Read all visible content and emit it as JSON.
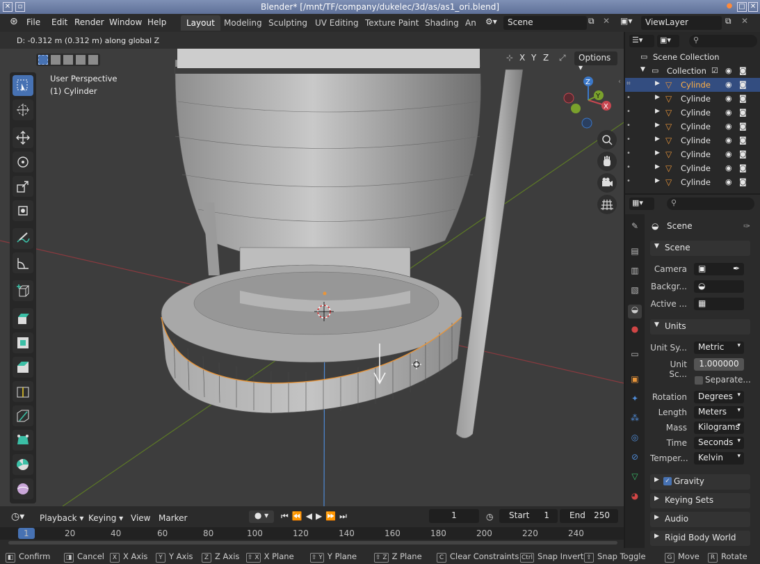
{
  "window": {
    "title": "Blender* [/mnt/TF/company/dukelec/3d/as/as1_ori.blend]"
  },
  "menu": [
    "File",
    "Edit",
    "Render",
    "Window",
    "Help"
  ],
  "workspaces": [
    "Layout",
    "Modeling",
    "Sculpting",
    "UV Editing",
    "Texture Paint",
    "Shading",
    "An"
  ],
  "scene_field": "Scene",
  "viewlayer_field": "ViewLayer",
  "viewport": {
    "status": "D: -0.312 m (0.312 m) along global Z",
    "perspective": "User Perspective",
    "object": "(1) Cylinder",
    "axis_x": "X",
    "axis_y": "Y",
    "axis_z": "Z",
    "options": "Options"
  },
  "gizmo": {
    "x": "X",
    "y": "Y",
    "z": "Z"
  },
  "outliner": {
    "scene_collection": "Scene Collection",
    "collection": "Collection",
    "items": [
      "Cylinde",
      "Cylinde",
      "Cylinde",
      "Cylinde",
      "Cylinde",
      "Cylinde",
      "Cylinde",
      "Cylinde"
    ]
  },
  "properties": {
    "header": "Scene",
    "scene_panel": "Scene",
    "camera_label": "Camera",
    "background_label": "Backgr...",
    "active_label": "Active ...",
    "units_panel": "Units",
    "unit_system_label": "Unit Sy...",
    "unit_system_value": "Metric",
    "unit_scale_label": "Unit Sc...",
    "unit_scale_value": "1.000000",
    "separate_label": "Separate...",
    "rotation_label": "Rotation",
    "rotation_value": "Degrees",
    "length_label": "Length",
    "length_value": "Meters",
    "mass_label": "Mass",
    "mass_value": "Kilograms",
    "time_label": "Time",
    "time_value": "Seconds",
    "temp_label": "Temper...",
    "temp_value": "Kelvin",
    "gravity": "Gravity",
    "keying_sets": "Keying Sets",
    "audio": "Audio",
    "rigid_body": "Rigid Body World"
  },
  "timeline": {
    "playback": "Playback",
    "keying": "Keying",
    "view": "View",
    "marker": "Marker",
    "current_frame": "1",
    "start_label": "Start",
    "start_value": "1",
    "end_label": "End",
    "end_value": "250",
    "ruler": [
      "1",
      "20",
      "40",
      "60",
      "80",
      "100",
      "120",
      "140",
      "160",
      "180",
      "200",
      "220",
      "240"
    ]
  },
  "statusbar": [
    {
      "key": "",
      "label": "Confirm"
    },
    {
      "key": "",
      "label": "Cancel"
    },
    {
      "key": "X",
      "label": "X Axis"
    },
    {
      "key": "Y",
      "label": "Y Axis"
    },
    {
      "key": "Z",
      "label": "Z Axis"
    },
    {
      "key": "⇧ X",
      "label": "X Plane"
    },
    {
      "key": "⇧ Y",
      "label": "Y Plane"
    },
    {
      "key": "⇧ Z",
      "label": "Z Plane"
    },
    {
      "key": "C",
      "label": "Clear Constraints"
    },
    {
      "key": "Ctrl",
      "label": "Snap Invert"
    },
    {
      "key": "⇧",
      "label": "Snap Toggle"
    },
    {
      "key": "G",
      "label": "Move"
    },
    {
      "key": "R",
      "label": "Rotate"
    }
  ],
  "colors": {
    "accent": "#4772b3",
    "selection_outline": "#e8953a",
    "axis_x": "#c84650",
    "axis_y": "#7aa12c",
    "axis_z": "#3b78c9"
  }
}
